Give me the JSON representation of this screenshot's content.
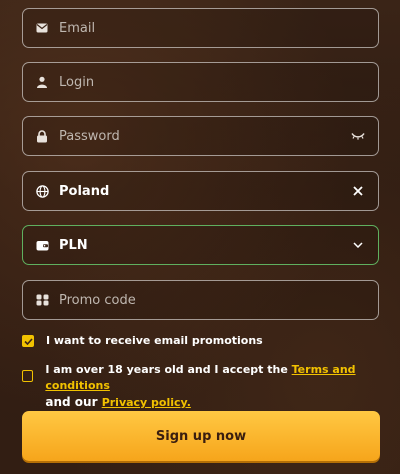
{
  "form": {
    "email": {
      "placeholder": "Email",
      "icon": "envelope-icon"
    },
    "login": {
      "placeholder": "Login",
      "icon": "user-icon"
    },
    "password": {
      "placeholder": "Password",
      "icon": "lock-icon",
      "toggle_icon": "eye-closed-icon"
    },
    "country": {
      "value": "Poland",
      "icon": "globe-icon",
      "clear_icon": "close-icon"
    },
    "currency": {
      "value": "PLN",
      "icon": "wallet-icon",
      "dropdown_icon": "chevron-down-icon"
    },
    "promo": {
      "placeholder": "Promo code",
      "icon": "gift-icon"
    }
  },
  "checkboxes": {
    "promotions": {
      "label": "I want to receive email promotions",
      "checked": true
    },
    "terms": {
      "text_1": "I am over 18 years old and I accept the",
      "link_terms": "Terms and conditions",
      "text_2": "and our",
      "link_privacy": "Privacy policy.",
      "checked": false
    }
  },
  "signup_button": {
    "label": "Sign up now"
  },
  "colors": {
    "accent": "#f2c200",
    "valid_border": "#5fb05f",
    "button": "#f6a51b"
  }
}
